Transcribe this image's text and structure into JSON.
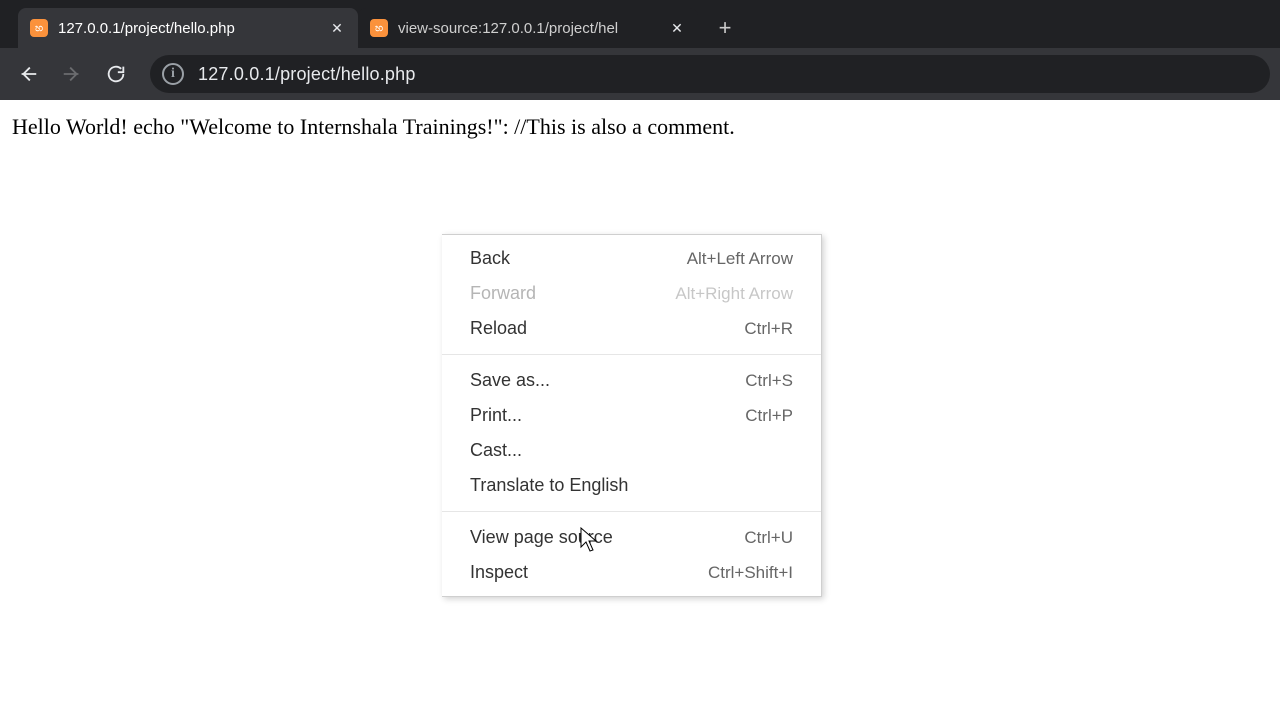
{
  "tabs": [
    {
      "title": "127.0.0.1/project/hello.php",
      "active": true
    },
    {
      "title": "view-source:127.0.0.1/project/hel",
      "active": false
    }
  ],
  "url": "127.0.0.1/project/hello.php",
  "page_text": "Hello World! echo \"Welcome to Internshala Trainings!\": //This is also a comment.",
  "context_menu": {
    "items": [
      {
        "label": "Back",
        "shortcut": "Alt+Left Arrow",
        "disabled": false
      },
      {
        "label": "Forward",
        "shortcut": "Alt+Right Arrow",
        "disabled": true
      },
      {
        "label": "Reload",
        "shortcut": "Ctrl+R",
        "disabled": false
      }
    ],
    "items2": [
      {
        "label": "Save as...",
        "shortcut": "Ctrl+S",
        "disabled": false
      },
      {
        "label": "Print...",
        "shortcut": "Ctrl+P",
        "disabled": false
      },
      {
        "label": "Cast...",
        "shortcut": "",
        "disabled": false
      },
      {
        "label": "Translate to English",
        "shortcut": "",
        "disabled": false
      }
    ],
    "items3": [
      {
        "label": "View page source",
        "shortcut": "Ctrl+U",
        "disabled": false
      },
      {
        "label": "Inspect",
        "shortcut": "Ctrl+Shift+I",
        "disabled": false
      }
    ]
  },
  "icons": {
    "favicon_glyph": "හ",
    "info_glyph": "i",
    "close_glyph": "✕",
    "plus_glyph": "+"
  }
}
